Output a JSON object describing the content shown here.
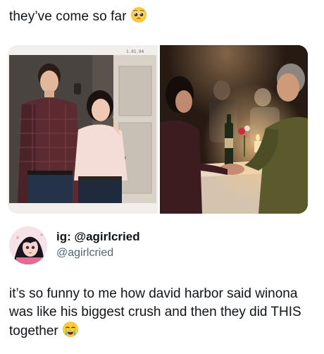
{
  "post": {
    "caption_top": "they’ve come so far",
    "caption_top_emoji": "pleading-face-emoji",
    "photo_left_date": "1.01.94",
    "author": {
      "display_name": "ig: @agirlcried",
      "handle": "@agirlcried"
    },
    "body_text": "it’s so funny to me how david harbor said winona was like his biggest crush and then they did THIS together",
    "body_emoji": "crying-face-emoji"
  }
}
